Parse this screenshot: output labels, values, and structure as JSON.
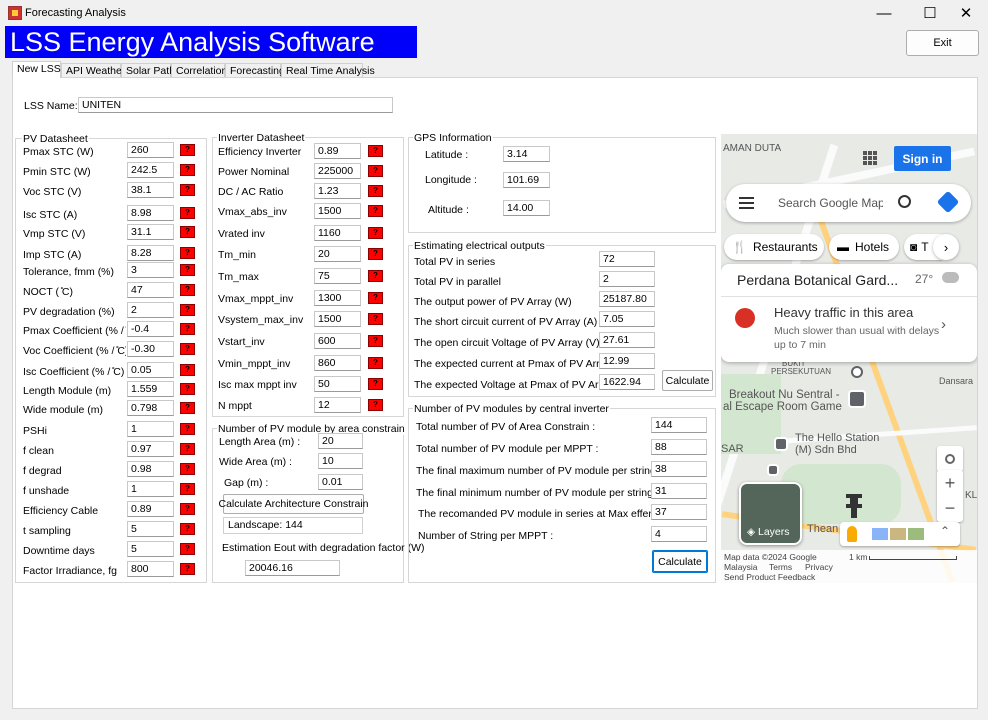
{
  "window": {
    "title": "Forecasting Analysis",
    "minimize": "—",
    "maximize": "☐",
    "close": "✕"
  },
  "banner": "LSS Energy Analysis Software",
  "exit_label": "Exit",
  "tabs": [
    "New LSS",
    "API Weather",
    "Solar Path",
    "Correlation",
    "Forecasting",
    "Real Time Analysis"
  ],
  "lss": {
    "label": "LSS Name:",
    "value": "UNITEN"
  },
  "pv_datasheet": {
    "title": "PV Datasheet",
    "rows": [
      {
        "label": "Pmax STC (W)",
        "value": "260"
      },
      {
        "label": "Pmin STC (W)",
        "value": "242.5"
      },
      {
        "label": "Voc STC (V)",
        "value": "38.1"
      },
      {
        "label": "Isc STC (A)",
        "value": "8.98"
      },
      {
        "label": "Vmp STC (V)",
        "value": "31.1"
      },
      {
        "label": "Imp STC (A)",
        "value": "8.28"
      },
      {
        "label": "Tolerance, fmm (%)",
        "value": "3"
      },
      {
        "label": "NOCT ( ̊C)",
        "value": "47"
      },
      {
        "label": "PV degradation (%)",
        "value": "2"
      },
      {
        "label": "Pmax Coefficient (% / ̊C)",
        "value": "-0.4"
      },
      {
        "label": "Voc Coefficient (% / ̊C)",
        "value": "-0.30"
      },
      {
        "label": "Isc Coefficient (% / ̊C)",
        "value": "0.05"
      },
      {
        "label": "Length Module (m)",
        "value": "1.559"
      },
      {
        "label": "Wide module (m)",
        "value": "0.798"
      },
      {
        "label": "PSHi",
        "value": "1"
      },
      {
        "label": "f clean",
        "value": "0.97"
      },
      {
        "label": "f degrad",
        "value": "0.98"
      },
      {
        "label": "f unshade",
        "value": "1"
      },
      {
        "label": "Efficiency Cable",
        "value": "0.89"
      },
      {
        "label": "t sampling",
        "value": "5"
      },
      {
        "label": "Downtime days",
        "value": "5"
      },
      {
        "label": "Factor Irradiance, fg",
        "value": "800"
      }
    ],
    "help": "?"
  },
  "inverter": {
    "title": "Inverter Datasheet",
    "rows": [
      {
        "label": "Efficiency Inverter",
        "value": "0.89"
      },
      {
        "label": "Power Nominal",
        "value": "225000"
      },
      {
        "label": "DC / AC Ratio",
        "value": "1.23"
      },
      {
        "label": "Vmax_abs_inv",
        "value": "1500"
      },
      {
        "label": "Vrated inv",
        "value": "1160"
      },
      {
        "label": "Tm_min",
        "value": "20"
      },
      {
        "label": "Tm_max",
        "value": "75"
      },
      {
        "label": "Vmax_mppt_inv",
        "value": "1300"
      },
      {
        "label": "Vsystem_max_inv",
        "value": "1500"
      },
      {
        "label": "Vstart_inv",
        "value": "600"
      },
      {
        "label": "Vmin_mppt_inv",
        "value": "860"
      },
      {
        "label": "Isc max mppt inv",
        "value": "50"
      },
      {
        "label": "N mppt",
        "value": "12"
      }
    ]
  },
  "area": {
    "title": "Number of PV module by area constrain",
    "length_label": "Length Area (m) :",
    "length_value": "20",
    "wide_label": "Wide Area (m) :",
    "wide_value": "10",
    "gap_label": "Gap (m) :",
    "gap_value": "0.01",
    "calc_button": "Calculate Architecture Constrain",
    "landscape": "Landscape: 144",
    "eout_label": "Estimation Eout with degradation factor (W)",
    "eout_value": "20046.16"
  },
  "gps": {
    "title": "GPS Information",
    "lat_label": "Latitude :",
    "lat_value": "3.14",
    "lon_label": "Longitude :",
    "lon_value": "101.69",
    "alt_label": "Altitude :",
    "alt_value": "14.00"
  },
  "electrical": {
    "title": "Estimating electrical outputs",
    "rows": [
      {
        "label": "Total PV in series",
        "value": "72"
      },
      {
        "label": "Total PV in parallel",
        "value": "2"
      },
      {
        "label": "The output power of PV Array (W)",
        "value": "25187.80"
      },
      {
        "label": "The short circuit current of PV Array (A)",
        "value": "7.05"
      },
      {
        "label": "The open circuit Voltage of PV Array (V)",
        "value": "27.61"
      },
      {
        "label": "The expected current at Pmax of PV Array (A)",
        "value": "12.99"
      },
      {
        "label": "The expected Voltage at Pmax of PV Array (V)",
        "value": "1622.94"
      }
    ],
    "calc_button": "Calculate"
  },
  "central": {
    "title": "Number of PV modules by central inverter",
    "rows": [
      {
        "label": "Total number of PV of Area Constrain :",
        "value": "144"
      },
      {
        "label": "Total number of PV module per MPPT :",
        "value": "88"
      },
      {
        "label": "The final maximum number of PV module per string :",
        "value": "38"
      },
      {
        "label": "The final minimum number of PV module per string :",
        "value": "31"
      },
      {
        "label": "The recomanded PV module in series at Max effenciency :",
        "value": "37"
      },
      {
        "label": "Number of String per MPPT :",
        "value": "4"
      }
    ],
    "calc_button": "Calculate"
  },
  "map": {
    "sign_in": "Sign in",
    "search_placeholder": "Search Google Maps",
    "chips": [
      "Restaurants",
      "Hotels",
      "T"
    ],
    "place_name": "Perdana Botanical Gard...",
    "temperature": "27°",
    "traffic_title": "Heavy traffic in this area",
    "traffic_desc": "Much slower than usual with delays up to 7 min",
    "labels": [
      "AMAN DUTA",
      "BUKIT",
      "PERSEKUTUAN",
      "Breakout Nu Sentral -",
      "al Escape Room Game",
      "The Hello Station",
      "(M) Sdn Bhd",
      "SAR",
      "Thean",
      "Dansara",
      "KL"
    ],
    "layers": "Layers",
    "footer": [
      "Map data ©2024 Google",
      "Malaysia",
      "Terms",
      "Privacy",
      "Send Product Feedback"
    ],
    "scale": "1 km"
  },
  "colors": {
    "banner_bg": "#0000fa",
    "help_red": "#ff0000",
    "sign_in_blue": "#1a73e8"
  }
}
